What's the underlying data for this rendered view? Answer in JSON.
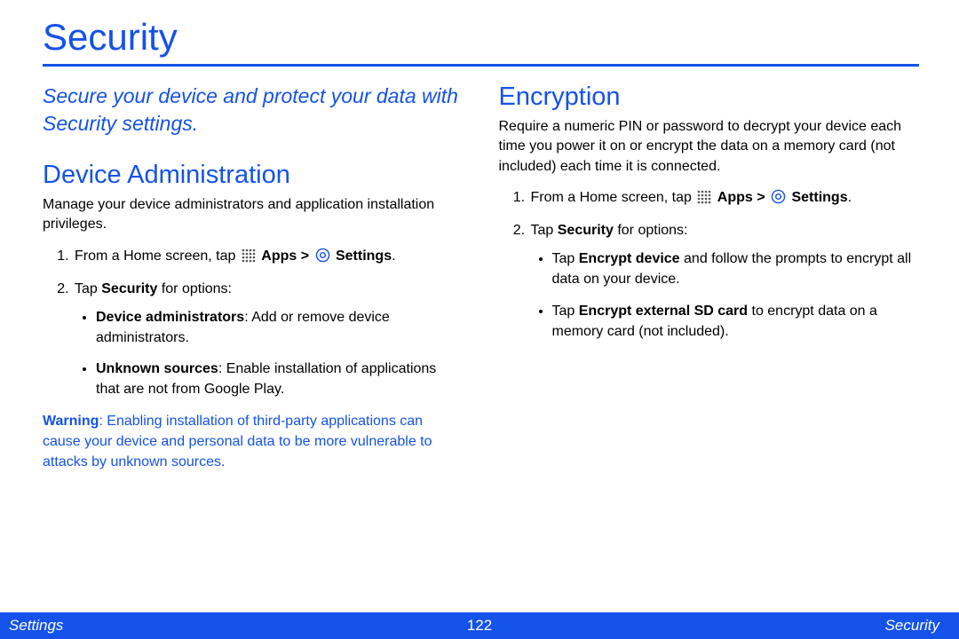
{
  "title": "Security",
  "subtitle": "Secure your device and protect your data with Security settings.",
  "left": {
    "heading": "Device Administration",
    "intro": "Manage your device administrators and application installation privileges.",
    "step1_a": "From a Home screen, tap ",
    "step1_apps": "Apps",
    "step1_gt": " > ",
    "step1_settings": "Settings",
    "step1_end": ".",
    "step2_a": "Tap ",
    "step2_b": "Security",
    "step2_c": " for options:",
    "bullet1_b": "Device administrators",
    "bullet1_t": ": Add or remove device administrators.",
    "bullet2_b": "Unknown sources",
    "bullet2_t": ": Enable installation of applications that are not from Google Play.",
    "warn_b": "Warning",
    "warn_t": ": Enabling installation of third-party applications can cause your device and personal data to be more vulnerable to attacks by unknown sources."
  },
  "right": {
    "heading": "Encryption",
    "intro": "Require a numeric PIN or password to decrypt your device each time you power it on or encrypt the data on a memory card (not included) each time it is connected.",
    "step1_a": "From a Home screen, tap ",
    "step1_apps": "Apps",
    "step1_gt": " > ",
    "step1_settings": "Settings",
    "step1_end": ".",
    "step2_a": "Tap ",
    "step2_b": "Security",
    "step2_c": " for options:",
    "bullet1_a": "Tap ",
    "bullet1_b": "Encrypt device",
    "bullet1_c": " and follow the prompts to encrypt all data on your device.",
    "bullet2_a": "Tap ",
    "bullet2_b": "Encrypt external SD card",
    "bullet2_c": " to encrypt data on a memory card (not included)."
  },
  "footer": {
    "left": "Settings",
    "center": "122",
    "right": "Security"
  }
}
